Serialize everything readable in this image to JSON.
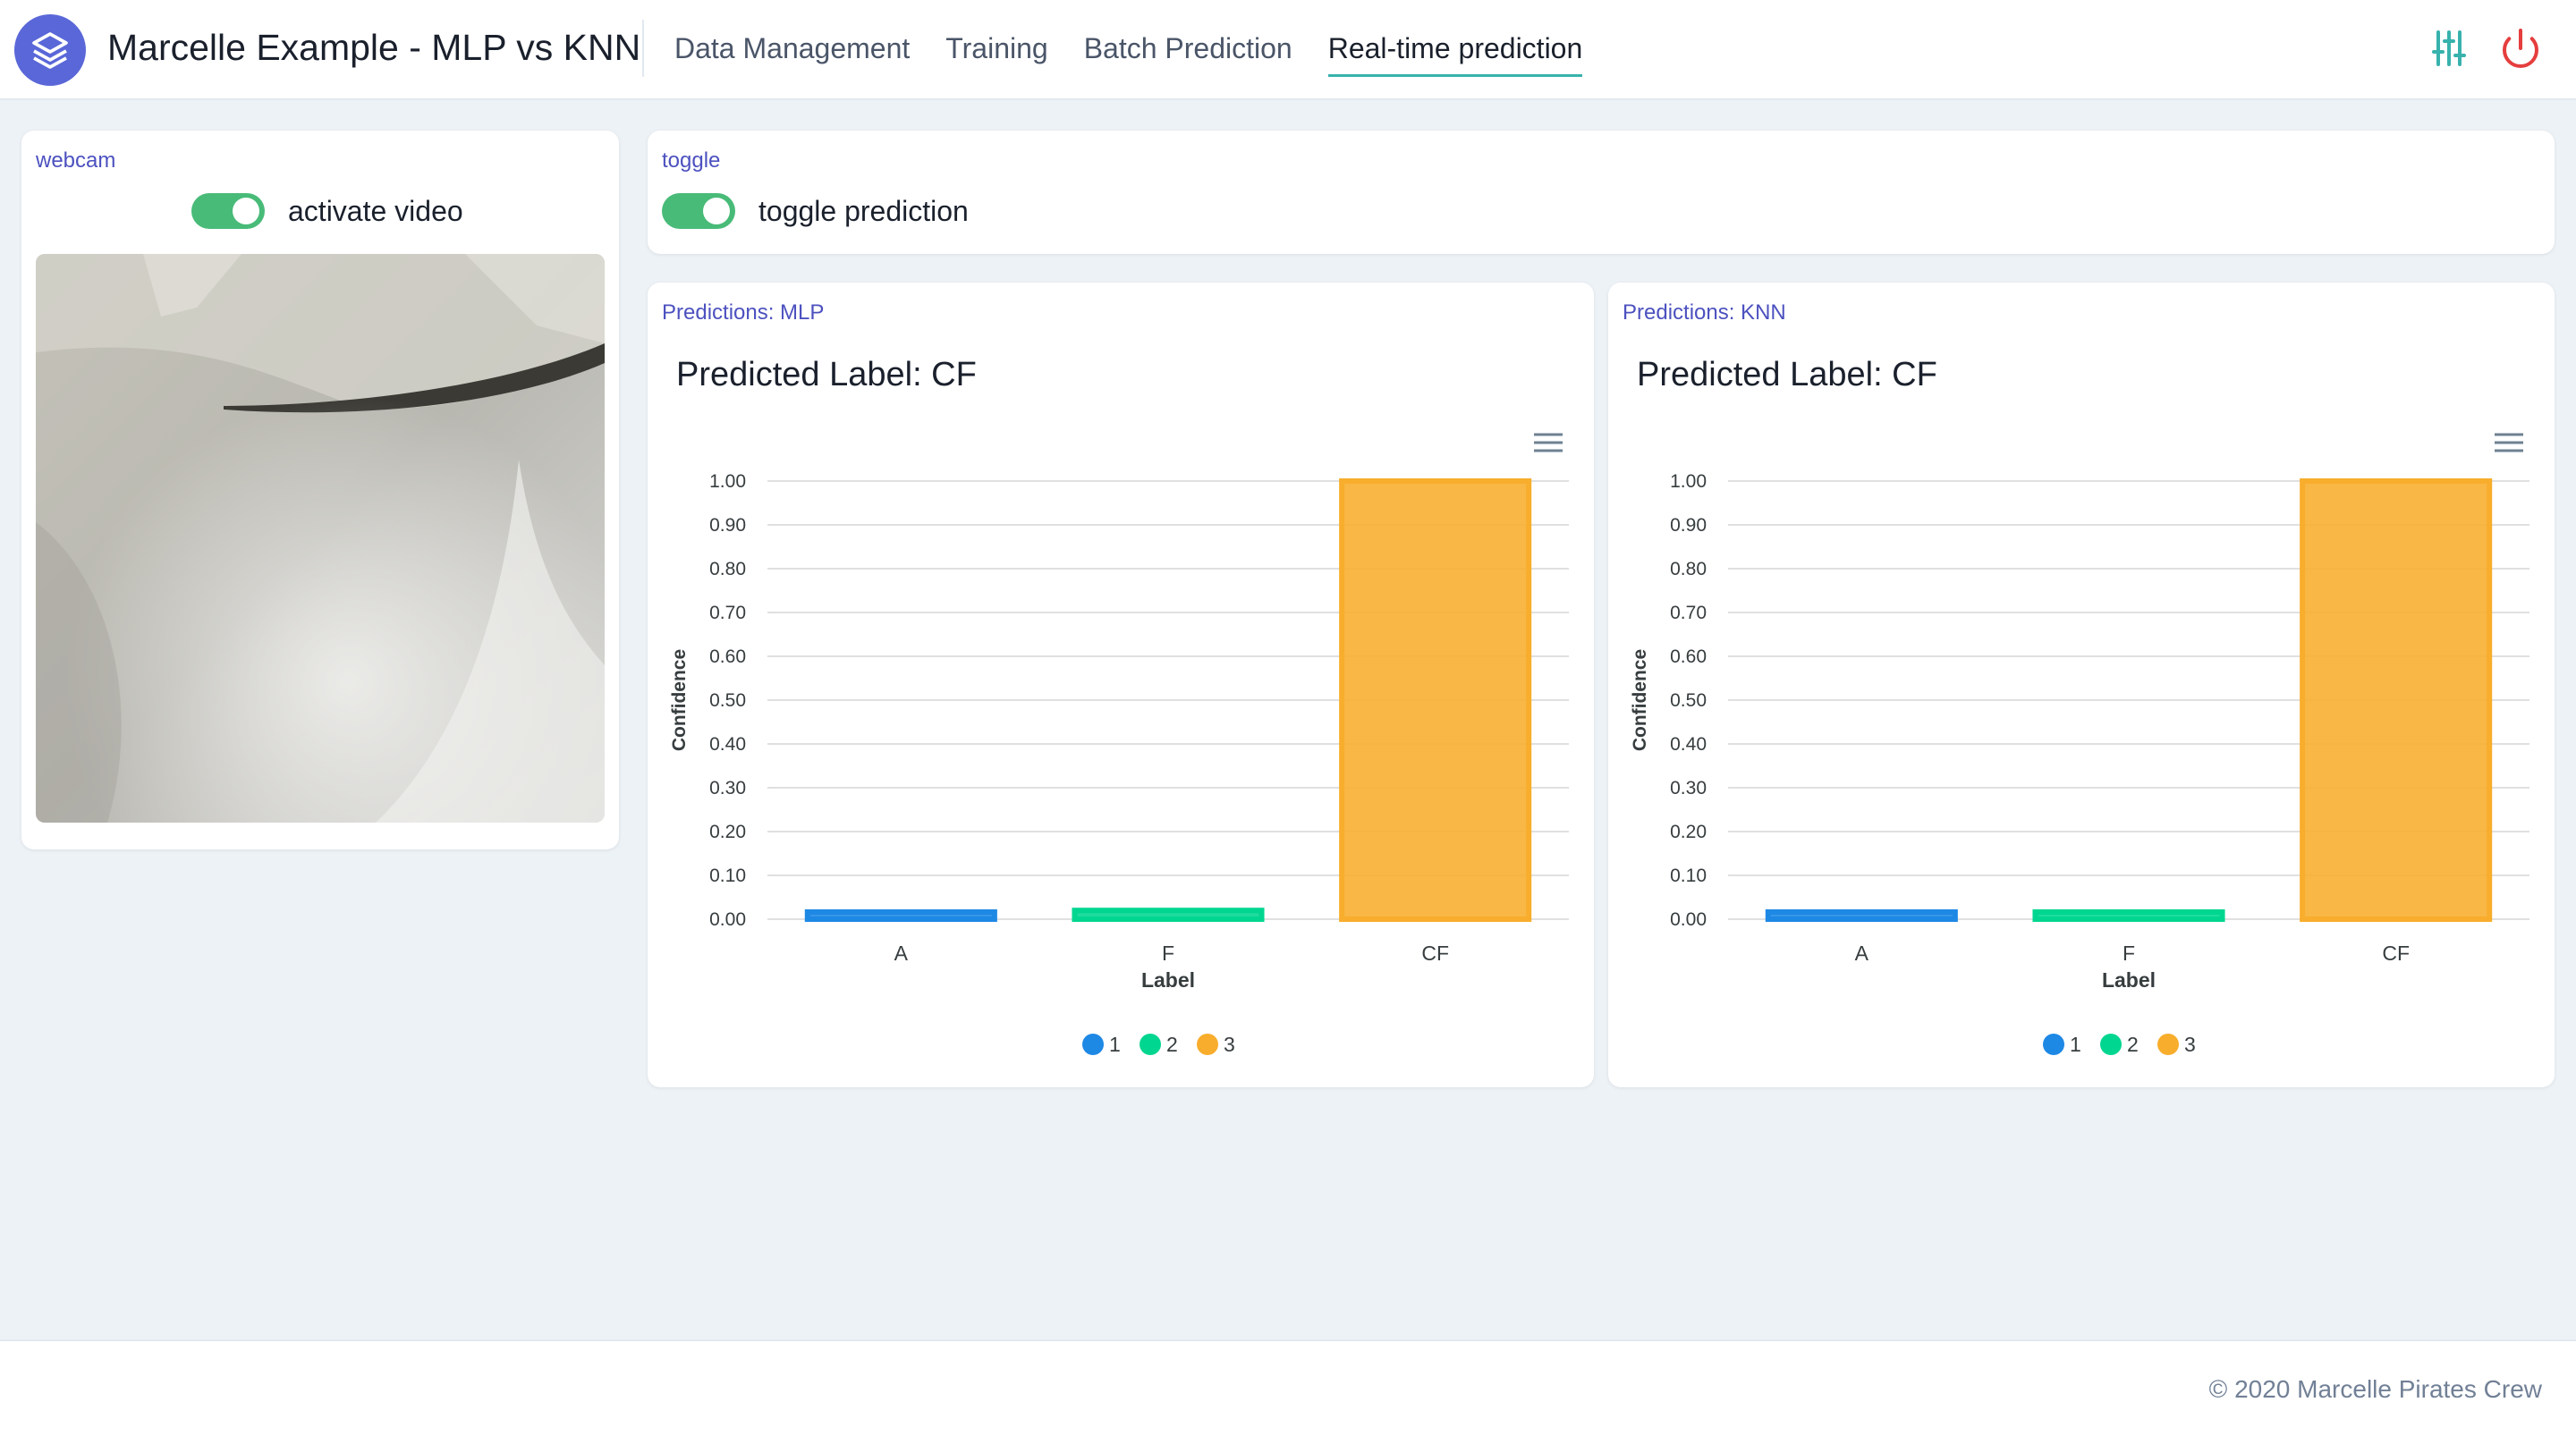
{
  "header": {
    "title": "Marcelle Example - MLP vs KNN",
    "nav": [
      {
        "label": "Data Management",
        "active": false
      },
      {
        "label": "Training",
        "active": false
      },
      {
        "label": "Batch Prediction",
        "active": false
      },
      {
        "label": "Real-time prediction",
        "active": true
      }
    ],
    "icons": {
      "logo": "layers-icon",
      "settings": "sliders-icon",
      "power": "power-icon"
    },
    "colors": {
      "accent": "#38b2ac",
      "logo_bg": "#5a67d8",
      "power": "#e53e3e"
    }
  },
  "webcam_panel": {
    "title": "webcam",
    "toggle_label": "activate video",
    "toggle_on": true
  },
  "toggle_panel": {
    "title": "toggle",
    "toggle_label": "toggle prediction",
    "toggle_on": true
  },
  "predictions": [
    {
      "title": "Predictions: MLP",
      "predicted_label": "Predicted Label: CF"
    },
    {
      "title": "Predictions: KNN",
      "predicted_label": "Predicted Label: CF"
    }
  ],
  "chart_data": [
    {
      "type": "bar",
      "categories": [
        "A",
        "F",
        "CF"
      ],
      "series": [
        {
          "name": "1",
          "values": [
            0.01,
            0,
            0
          ],
          "color": "#1e88e5"
        },
        {
          "name": "2",
          "values": [
            0,
            0.02,
            0
          ],
          "color": "#00d68f"
        },
        {
          "name": "3",
          "values": [
            0,
            0,
            1.0
          ],
          "color": "#f8ad2c"
        }
      ],
      "xlabel": "Label",
      "ylabel": "Confidence",
      "ylim": [
        0,
        1
      ],
      "yticks": [
        "0.00",
        "0.10",
        "0.20",
        "0.30",
        "0.40",
        "0.50",
        "0.60",
        "0.70",
        "0.80",
        "0.90",
        "1.00"
      ],
      "legend": "bottom-center",
      "grid": true
    },
    {
      "type": "bar",
      "categories": [
        "A",
        "F",
        "CF"
      ],
      "series": [
        {
          "name": "1",
          "values": [
            0.01,
            0,
            0
          ],
          "color": "#1e88e5"
        },
        {
          "name": "2",
          "values": [
            0,
            0.01,
            0
          ],
          "color": "#00d68f"
        },
        {
          "name": "3",
          "values": [
            0,
            0,
            1.0
          ],
          "color": "#f8ad2c"
        }
      ],
      "xlabel": "Label",
      "ylabel": "Confidence",
      "ylim": [
        0,
        1
      ],
      "yticks": [
        "0.00",
        "0.10",
        "0.20",
        "0.30",
        "0.40",
        "0.50",
        "0.60",
        "0.70",
        "0.80",
        "0.90",
        "1.00"
      ],
      "legend": "bottom-center",
      "grid": true
    }
  ],
  "footer": {
    "text": "© 2020 Marcelle Pirates Crew"
  }
}
